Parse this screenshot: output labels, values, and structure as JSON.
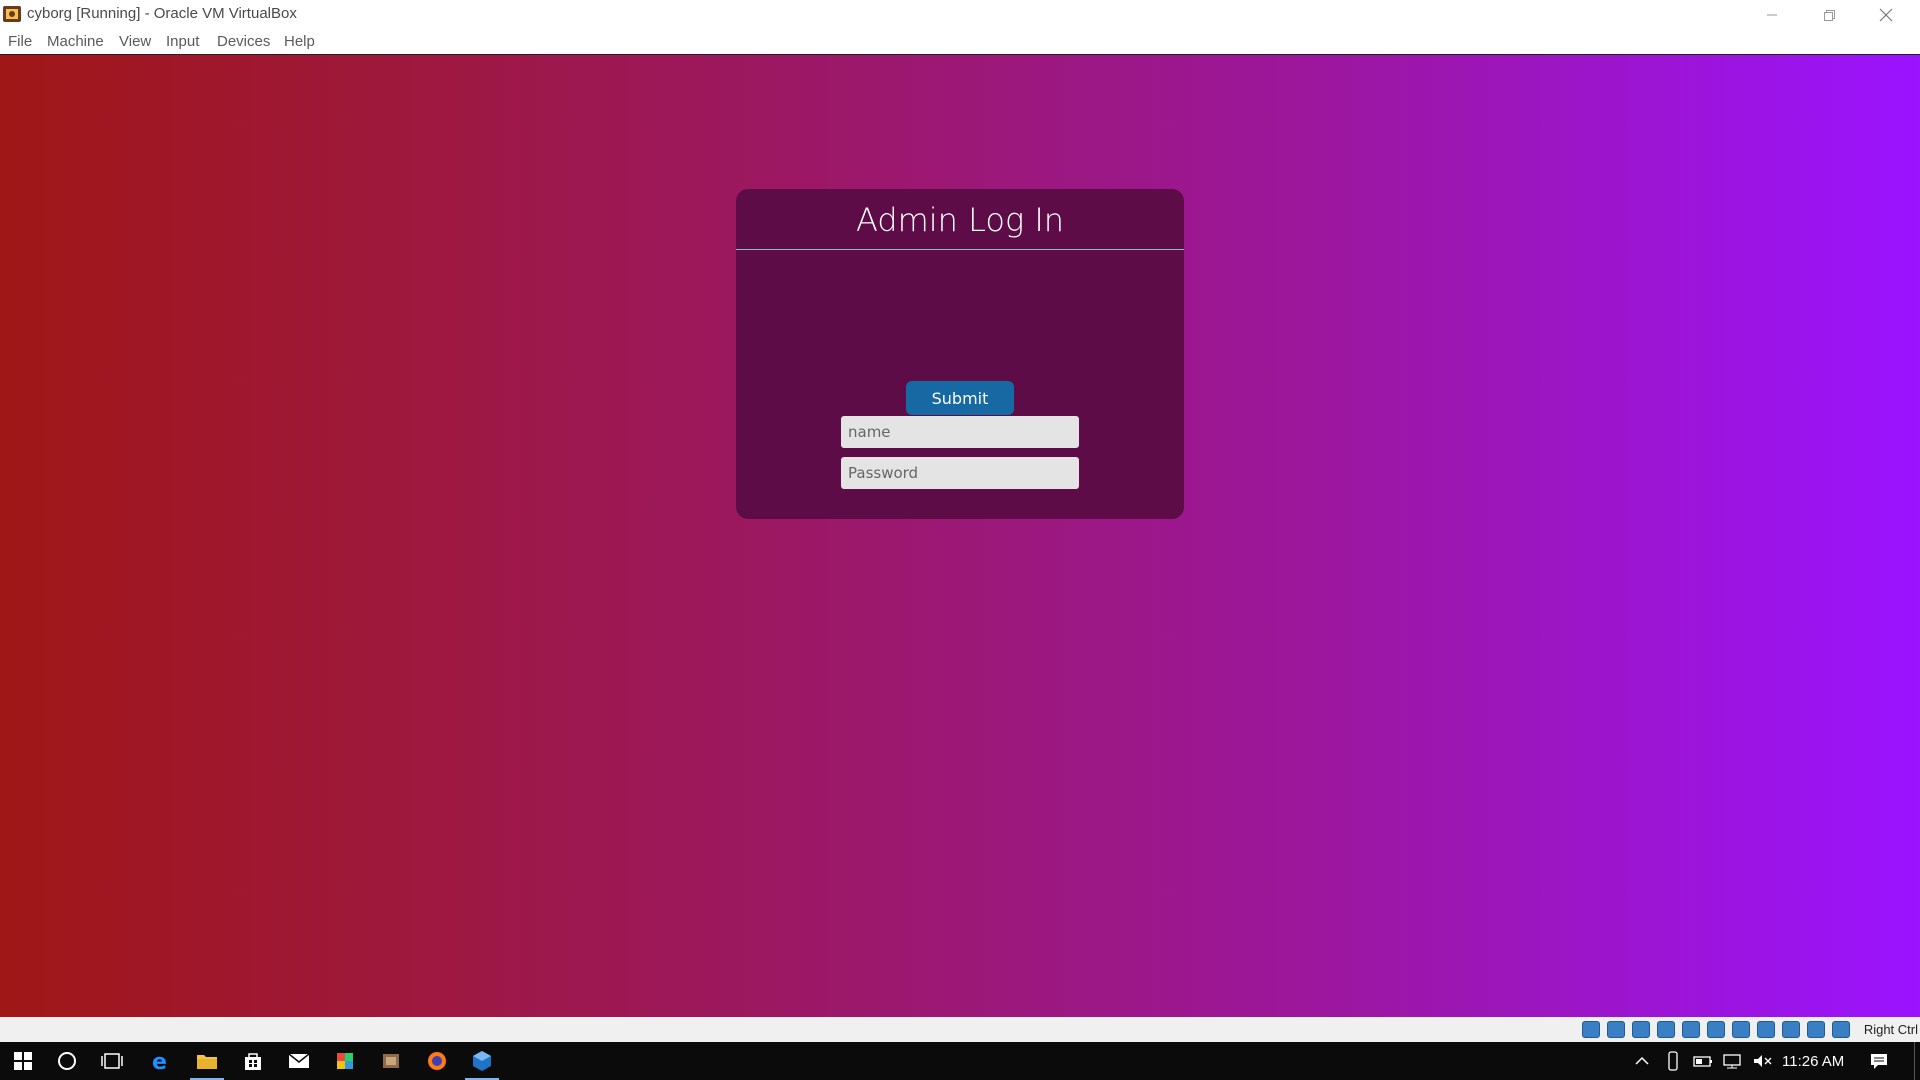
{
  "window": {
    "title": "cyborg [Running] - Oracle VM VirtualBox",
    "menu": [
      "File",
      "Machine",
      "View",
      "Input",
      "Devices",
      "Help"
    ]
  },
  "login": {
    "heading": "Admin Log In",
    "name_placeholder": "name",
    "password_placeholder": "Password",
    "submit_label": "Submit"
  },
  "vbox_status": {
    "icons": [
      "hard-disk-icon",
      "optical-drive-icon",
      "audio-icon",
      "network-icon",
      "usb-icon",
      "shared-folders-icon",
      "display-icon",
      "video-capture-icon",
      "cpu-icon",
      "mouse-integration-icon",
      "keyboard-icon"
    ],
    "host_key": "Right Ctrl"
  },
  "taskbar": {
    "apps": [
      "start-icon",
      "cortana-icon",
      "task-view-icon",
      "edge-icon",
      "file-explorer-icon",
      "store-icon",
      "mail-icon",
      "office-icon",
      "app-icon",
      "firefox-icon",
      "virtualbox-icon"
    ],
    "clock": "11:26 AM"
  },
  "colors": {
    "gradient_start": "#a01717",
    "gradient_end": "#9b13ff",
    "card": "#5e0c47",
    "submit": "#1669a3"
  }
}
